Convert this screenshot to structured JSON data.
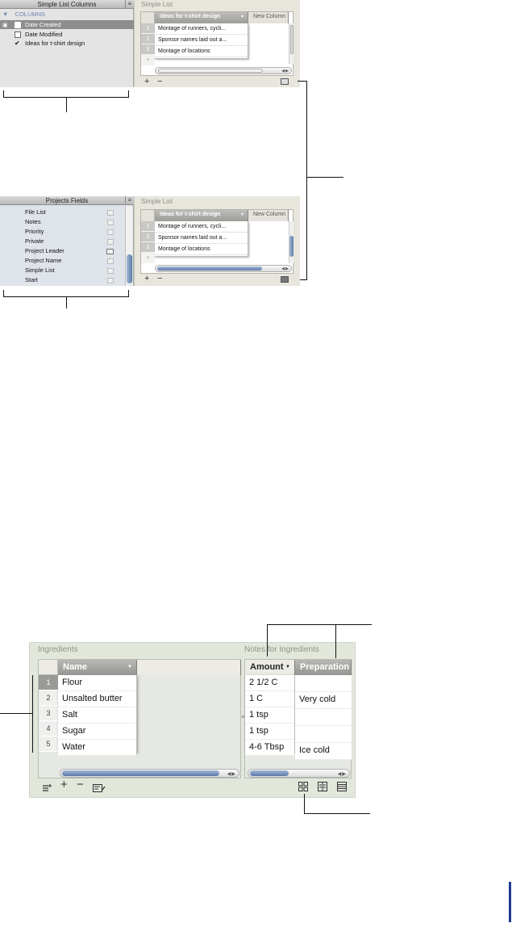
{
  "panel1": {
    "sidebar": {
      "title": "Simple List Columns",
      "menu_glyph": "≡",
      "section_label": "COLUMNS",
      "items": [
        {
          "label": "Date Created",
          "checked": false,
          "selected": true
        },
        {
          "label": "Date Modified",
          "checked": false,
          "selected": false
        },
        {
          "label": "Ideas for t-shirt design",
          "checked": true,
          "selected": false
        }
      ]
    },
    "list": {
      "title": "Simple List",
      "headers": [
        "Ideas for t-shirt design",
        "New Column"
      ],
      "rows": [
        {
          "num": "1",
          "text": "Montage of runners, cycli..."
        },
        {
          "num": "2",
          "text": "Sponsor names laid out a..."
        },
        {
          "num": "3",
          "text": "Montage of locations"
        }
      ],
      "add_row": "+",
      "add_label": "+",
      "remove_label": "−"
    }
  },
  "panel2": {
    "sidebar": {
      "title": "Projects Fields",
      "menu_glyph": "≡",
      "items": [
        {
          "label": "File List"
        },
        {
          "label": "Notes"
        },
        {
          "label": "Priority"
        },
        {
          "label": "Private"
        },
        {
          "label": "Project Leader"
        },
        {
          "label": "Project Name"
        },
        {
          "label": "Simple List"
        },
        {
          "label": "Start"
        }
      ]
    },
    "list": {
      "title": "Simple List",
      "headers": [
        "Ideas for t-shirt design",
        "New Column"
      ],
      "rows": [
        {
          "num": "1",
          "text": "Montage of runners, cycli..."
        },
        {
          "num": "2",
          "text": "Sponsor names laid out a..."
        },
        {
          "num": "3",
          "text": "Montage of locations"
        }
      ],
      "add_row": "+",
      "add_label": "+",
      "remove_label": "−"
    }
  },
  "ingredients": {
    "title": "Ingredients",
    "header": "Name",
    "rows": [
      {
        "num": "1",
        "name": "Flour"
      },
      {
        "num": "2",
        "name": "Unsalted butter"
      },
      {
        "num": "3",
        "name": "Salt"
      },
      {
        "num": "4",
        "name": "Sugar"
      },
      {
        "num": "5",
        "name": "Water"
      }
    ]
  },
  "notes": {
    "title": "Notes for Ingredients",
    "headers": [
      "Amount",
      "Preparation"
    ],
    "rows": [
      {
        "amount": "2 1/2 C",
        "prep": ""
      },
      {
        "amount": "1 C",
        "prep": "Very cold"
      },
      {
        "amount": "1 tsp",
        "prep": ""
      },
      {
        "amount": "1 tsp",
        "prep": ""
      },
      {
        "amount": "4-6 Tbsp",
        "prep": "Ice cold"
      }
    ]
  },
  "toolbar": {
    "add_label": "+",
    "remove_label": "−"
  },
  "colors": {
    "accent_blue": "#5c7aa8",
    "page_marker": "#1f3a93"
  }
}
